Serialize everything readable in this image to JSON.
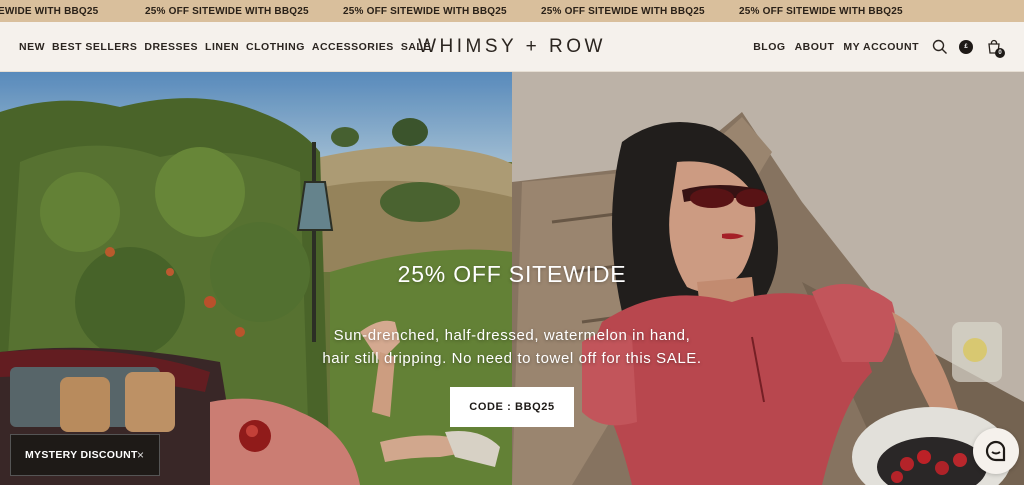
{
  "announcement": {
    "items": [
      "EWIDE WITH BBQ25",
      "25% OFF SITEWIDE WITH BBQ25",
      "25% OFF SITEWIDE WITH BBQ25",
      "25% OFF SITEWIDE WITH BBQ25",
      "25% OFF SITEWIDE WITH BBQ25"
    ],
    "bg_color": "#d9bf9c"
  },
  "header": {
    "nav_left": [
      "NEW",
      "BEST SELLERS",
      "DRESSES",
      "LINEN",
      "CLOTHING",
      "ACCESSORIES",
      "SALE"
    ],
    "logo": "WHIMSY + ROW",
    "nav_right": [
      "BLOG",
      "ABOUT",
      "MY ACCOUNT"
    ],
    "icons": [
      "search-icon",
      "currency-icon",
      "cart-icon"
    ],
    "currency_symbol": "£",
    "cart_count": "0"
  },
  "hero": {
    "title": "25% OFF SITEWIDE",
    "body_line1": "Sun-drenched, half-dressed, watermelon in hand,",
    "body_line2": "hair still dripping. No need to towel off for this SALE.",
    "cta_label": "CODE : BBQ25"
  },
  "mystery": {
    "label": "MYSTERY DISCOUNT",
    "close": "×"
  },
  "chat": {
    "icon": "chat-icon"
  }
}
